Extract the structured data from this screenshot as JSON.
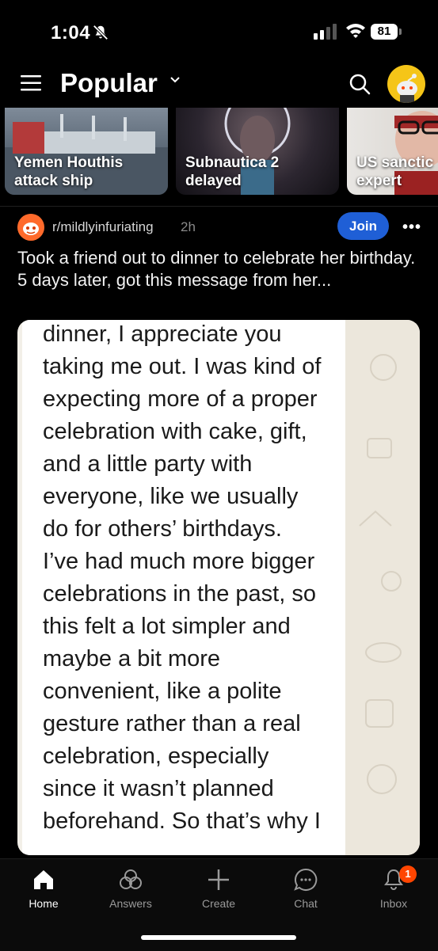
{
  "status": {
    "time": "1:04",
    "battery": "81"
  },
  "header": {
    "title": "Popular"
  },
  "carousel": [
    {
      "caption_line1": "Yemen Houthis",
      "caption_line2": "attack ship"
    },
    {
      "caption_line1": "Subnautica 2",
      "caption_line2": "delayed"
    },
    {
      "caption_line1": "US sanctic",
      "caption_line2": "expert"
    }
  ],
  "post": {
    "subreddit": "r/mildlyinfuriating",
    "age": "2h",
    "join_label": "Join",
    "title": "Took a friend out to dinner to celebrate her birthday. 5 days later, got this message from her...",
    "image_text_lines": [
      "dinner, I appreciate you",
      "taking me out. I was kind of",
      "expecting more of a proper",
      "celebration with cake, gift,",
      "and a little party with",
      "everyone, like we usually",
      "do for others’ birthdays.",
      "I’ve had much more bigger",
      "celebrations in the past, so",
      "this felt a lot simpler and",
      "maybe a bit more",
      "convenient, like a polite",
      "gesture rather than a real",
      "celebration, especially",
      "since it wasn’t planned",
      "beforehand. So that’s why I"
    ]
  },
  "tabs": [
    {
      "label": "Home",
      "icon": "home-icon"
    },
    {
      "label": "Answers",
      "icon": "answers-icon"
    },
    {
      "label": "Create",
      "icon": "plus-icon"
    },
    {
      "label": "Chat",
      "icon": "chat-icon"
    },
    {
      "label": "Inbox",
      "icon": "bell-icon",
      "badge": "1"
    }
  ],
  "colors": {
    "join": "#1f5fd6",
    "badge": "#ff4500",
    "avatar": "#f5c518"
  }
}
